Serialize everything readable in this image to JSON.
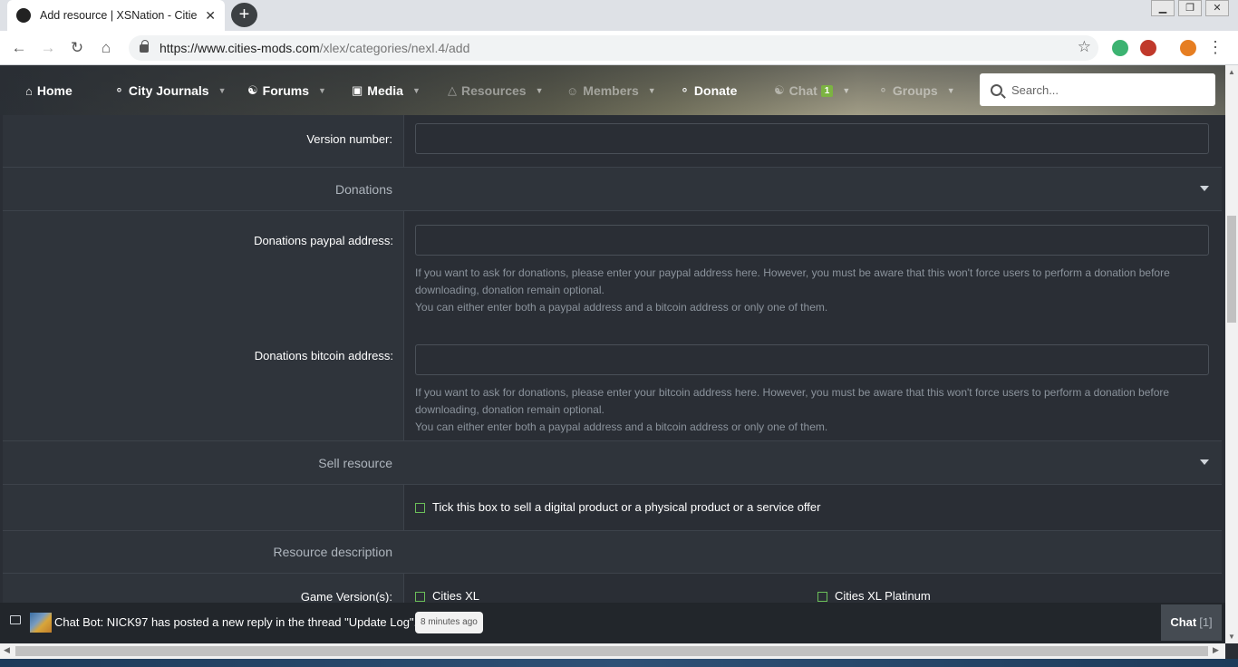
{
  "browser": {
    "tab_title": "Add resource | XSNation - Cities",
    "tab_close": "✕",
    "new_tab": "+",
    "url_host": "https://www.cities-mods.com",
    "url_path": "/xlex/categories/nexl.4/add",
    "window_controls": [
      "▁",
      "❐",
      "✕"
    ]
  },
  "site_nav": {
    "items": [
      {
        "label": "Home",
        "icon": "home-icon"
      },
      {
        "label": "City Journals",
        "icon": "tag-icon"
      },
      {
        "label": "Forums",
        "icon": "comments-icon"
      },
      {
        "label": "Media",
        "icon": "image-icon"
      },
      {
        "label": "Resources",
        "icon": "resources-icon"
      },
      {
        "label": "Members",
        "icon": "user-icon"
      },
      {
        "label": "Donate",
        "icon": "tag-icon"
      },
      {
        "label": "Chat",
        "icon": "comments-icon",
        "badge": "1"
      },
      {
        "label": "Groups",
        "icon": "tag-icon"
      }
    ],
    "search_placeholder": "Search..."
  },
  "form": {
    "version_label": "Version number:",
    "donations_section": "Donations",
    "paypal_label": "Donations paypal address:",
    "paypal_hint_1": "If you want to ask for donations, please enter your paypal address here. However, you must be aware that this won't force users to perform a donation before downloading, donation remain optional.",
    "paypal_hint_2": "You can either enter both a paypal address and a bitcoin address or only one of them.",
    "bitcoin_label": "Donations bitcoin address:",
    "bitcoin_hint_1": "If you want to ask for donations, please enter your bitcoin address here. However, you must be aware that this won't force users to perform a donation before downloading, donation remain optional.",
    "bitcoin_hint_2": "You can either enter both a paypal address and a bitcoin address or only one of them.",
    "sell_section": "Sell resource",
    "sell_checkbox": "Tick this box to sell a digital product or a physical product or a service offer",
    "description_section": "Resource description",
    "game_version_label": "Game Version(s):",
    "game_versions": [
      "Cities XL",
      "Cities XL Platinum"
    ]
  },
  "notice": {
    "text": "Chat Bot: NICK97 has posted a new reply in the thread \"Update Log\".",
    "time": "8 minutes ago",
    "chat_label": "Chat",
    "chat_count": "[1]"
  },
  "colors": {
    "accent_green": "#7cb342",
    "page_bg": "#2a2e35"
  }
}
